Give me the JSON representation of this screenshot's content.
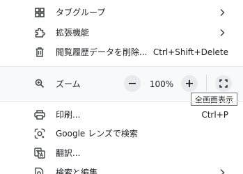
{
  "menu": {
    "tab_groups": {
      "label": "タブグループ",
      "icon": "tab-groups-icon"
    },
    "extensions": {
      "label": "拡張機能",
      "icon": "extension-icon"
    },
    "clear_data": {
      "label": "閲覧履歴データを削除...",
      "shortcut": "Ctrl+Shift+Delete",
      "icon": "trash-icon"
    },
    "zoom": {
      "label": "ズーム",
      "value": "100%",
      "minus": "−",
      "plus": "+",
      "icon": "zoom-icon",
      "fullscreen_icon": "fullscreen-icon",
      "fullscreen_tooltip": "全画面表示"
    },
    "print": {
      "label": "印刷...",
      "shortcut": "Ctrl+P",
      "icon": "print-icon"
    },
    "google_lens": {
      "label": "Google レンズで検索",
      "icon": "google-lens-icon"
    },
    "translate": {
      "label": "翻訳...",
      "icon": "translate-icon"
    },
    "find_edit": {
      "label": "検索と編集",
      "icon": "find-edit-icon"
    }
  },
  "colors": {
    "background": "#ffffff",
    "zoom_zone": "#f8f9fa",
    "button": "#e8eaed",
    "text": "#202124",
    "icon": "#444746"
  }
}
